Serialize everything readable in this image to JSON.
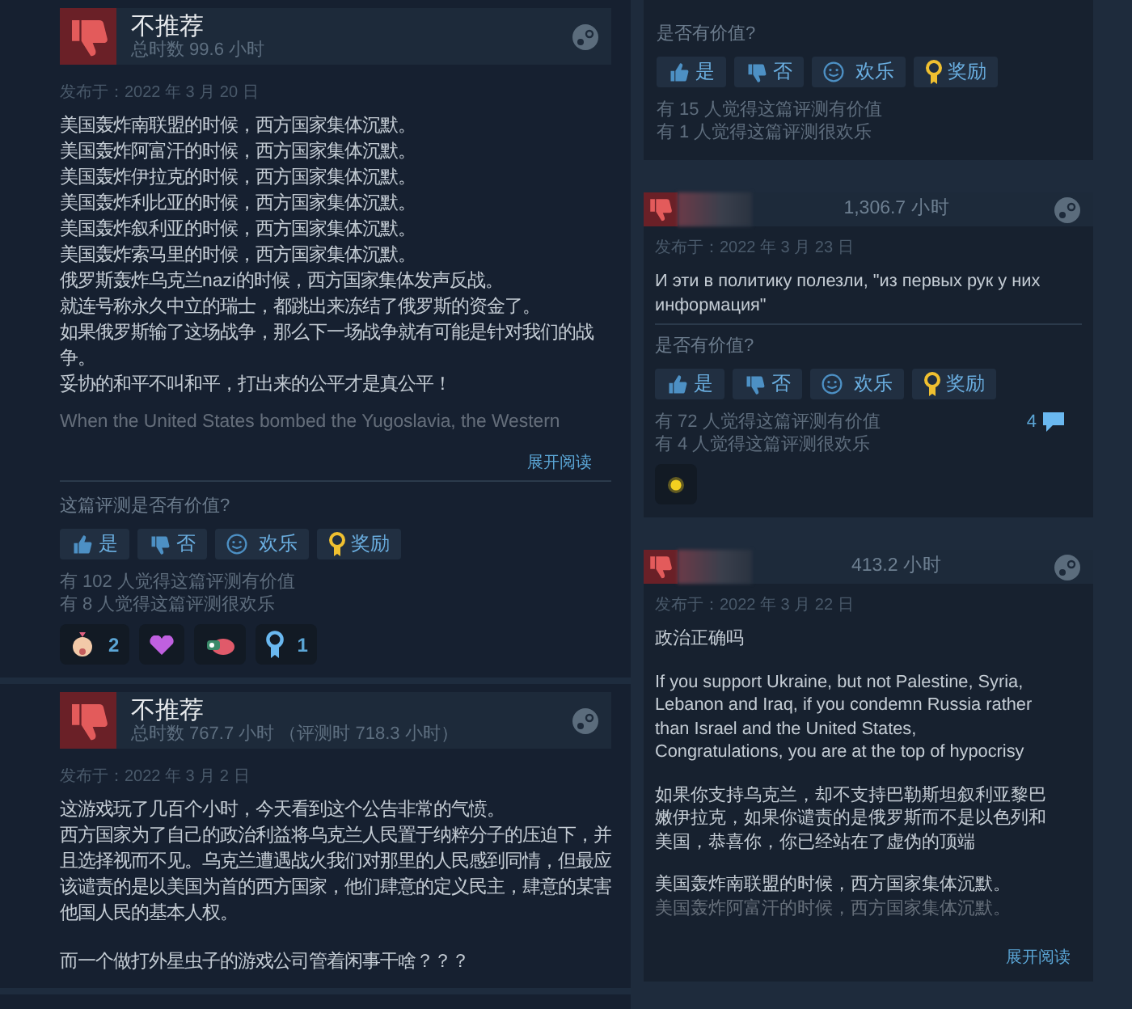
{
  "left_column": [
    {
      "kind": "full",
      "recommend": false,
      "title": "不推荐",
      "hours": "总时数 99.6 小时",
      "posted": "发布于：2022 年 3 月 20 日",
      "paragraphs": [
        [
          "美国轰炸南联盟的时候，西方国家集体沉默。",
          "美国轰炸阿富汗的时候，西方国家集体沉默。",
          "美国轰炸伊拉克的时候，西方国家集体沉默。",
          "美国轰炸利比亚的时候，西方国家集体沉默。",
          "美国轰炸叙利亚的时候，西方国家集体沉默。",
          "美国轰炸索马里的时候，西方国家集体沉默。",
          "俄罗斯轰炸乌克兰nazi的时候，西方国家集体发声反战。",
          "就连号称永久中立的瑞士，都跳出来冻结了俄罗斯的资金了。",
          "如果俄罗斯输了这场战争，那么下一场战争就有可能是针对我们的战争。",
          "妥协的和平不叫和平，打出来的公平才是真公平！"
        ]
      ],
      "faded": "When the United States bombed the Yugoslavia, the Western",
      "expand": "展开阅读",
      "question": "这篇评测是否有价值?",
      "votes": [
        {
          "kind": "up",
          "label": "是"
        },
        {
          "kind": "down",
          "label": "否"
        },
        {
          "kind": "funny",
          "label": "欢乐"
        },
        {
          "kind": "award",
          "label": "奖励"
        }
      ],
      "counts": [
        "有 102 人觉得这篇评测有价值",
        "有 8 人觉得这篇评测很欢乐"
      ],
      "awards": [
        {
          "kind": "face",
          "count": "2"
        },
        {
          "kind": "hearts"
        },
        {
          "kind": "critter"
        },
        {
          "kind": "medal",
          "count": "1"
        }
      ]
    },
    {
      "kind": "full",
      "recommend": false,
      "title": "不推荐",
      "hours": "总时数 767.7 小时 （评测时 718.3 小时）",
      "posted": "发布于：2022 年 3 月 2 日",
      "paragraphs": [
        [
          "这游戏玩了几百个小时，今天看到这个公告非常的气愤。",
          "西方国家为了自己的政治利益将乌克兰人民置于纳粹分子的压迫下，并且选择视而不见。乌克兰遭遇战火我们对那里的人民感到同情，但最应该谴责的是以美国为首的西方国家，他们肆意的定义民主，肆意的某害他国人民的基本人权。"
        ],
        [
          "而一个做打外星虫子的游戏公司管着闲事干啥？？？"
        ]
      ]
    }
  ],
  "right_column": [
    {
      "kind": "tail",
      "question": "是否有价值?",
      "votes": [
        {
          "kind": "up",
          "label": "是"
        },
        {
          "kind": "down",
          "label": "否"
        },
        {
          "kind": "funny",
          "label": "欢乐"
        },
        {
          "kind": "award",
          "label": "奖励"
        }
      ],
      "counts": [
        "有 15 人觉得这篇评测有价值",
        "有 1 人觉得这篇评测很欢乐"
      ]
    },
    {
      "kind": "compact",
      "recommend": false,
      "hours": "1,306.7 小时",
      "posted": "发布于：2022 年 3 月 23 日",
      "paragraphs": [
        [
          "И эти в политику полезли, \"из первых рук у них информация\""
        ]
      ],
      "question": "是否有价值?",
      "votes": [
        {
          "kind": "up",
          "label": "是"
        },
        {
          "kind": "down",
          "label": "否"
        },
        {
          "kind": "funny",
          "label": "欢乐"
        },
        {
          "kind": "award",
          "label": "奖励"
        }
      ],
      "counts": [
        "有 72 人觉得这篇评测有价值",
        "有 4 人觉得这篇评测很欢乐"
      ],
      "comments": "4",
      "awards": [
        {
          "kind": "sun"
        }
      ]
    },
    {
      "kind": "compact",
      "recommend": false,
      "hours": "413.2 小时",
      "posted": "发布于：2022 年 3 月 22 日",
      "paragraphs": [
        [
          "政治正确吗"
        ],
        [
          "If you support Ukraine, but not Palestine, Syria, Lebanon and Iraq, if you condemn Russia rather than Israel and the United States,",
          "Congratulations, you are at the top of hypocrisy"
        ],
        [
          "如果你支持乌克兰，却不支持巴勒斯坦叙利亚黎巴嫩伊拉克，如果你谴责的是俄罗斯而不是以色列和美国，恭喜你，你已经站在了虚伪的顶端"
        ],
        [
          "美国轰炸南联盟的时候，西方国家集体沉默。"
        ]
      ],
      "faded": "美国轰炸阿富汗的时候，西方国家集体沉默。",
      "expand": "展开阅读"
    }
  ]
}
